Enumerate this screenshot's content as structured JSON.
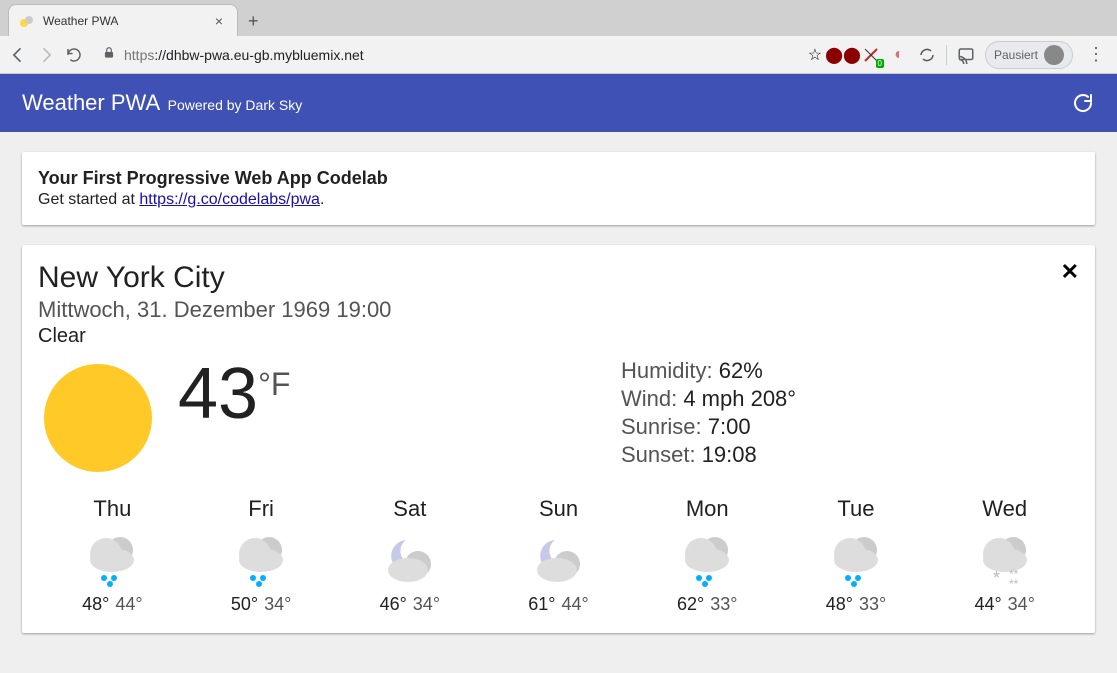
{
  "browser": {
    "tab_title": "Weather PWA",
    "url_protocol": "https",
    "url_host": "://dhbw-pwa.eu-gb.mybluemix.net",
    "profile_label": "Pausiert"
  },
  "app": {
    "title": "Weather PWA",
    "subtitle": "Powered by Dark Sky"
  },
  "intro": {
    "title": "Your First Progressive Web App Codelab",
    "text_prefix": "Get started at ",
    "link_text": "https://g.co/codelabs/pwa",
    "text_suffix": "."
  },
  "weather": {
    "city": "New York City",
    "date": "Mittwoch, 31. Dezember 1969 19:00",
    "description": "Clear",
    "temp_value": "43",
    "temp_unit": "°F",
    "stats": {
      "humidity_label": "Humidity:",
      "humidity_value": "62%",
      "wind_label": "Wind:",
      "wind_value": "4 mph 208°",
      "sunrise_label": "Sunrise:",
      "sunrise_value": "7:00",
      "sunset_label": "Sunset:",
      "sunset_value": "19:08"
    },
    "forecast": [
      {
        "day": "Thu",
        "hi": "48°",
        "lo": "44°",
        "icon": "rain"
      },
      {
        "day": "Fri",
        "hi": "50°",
        "lo": "34°",
        "icon": "rain"
      },
      {
        "day": "Sat",
        "hi": "46°",
        "lo": "34°",
        "icon": "night-cloudy"
      },
      {
        "day": "Sun",
        "hi": "61°",
        "lo": "44°",
        "icon": "night-cloudy"
      },
      {
        "day": "Mon",
        "hi": "62°",
        "lo": "33°",
        "icon": "rain"
      },
      {
        "day": "Tue",
        "hi": "48°",
        "lo": "33°",
        "icon": "rain"
      },
      {
        "day": "Wed",
        "hi": "44°",
        "lo": "34°",
        "icon": "snow"
      }
    ]
  }
}
